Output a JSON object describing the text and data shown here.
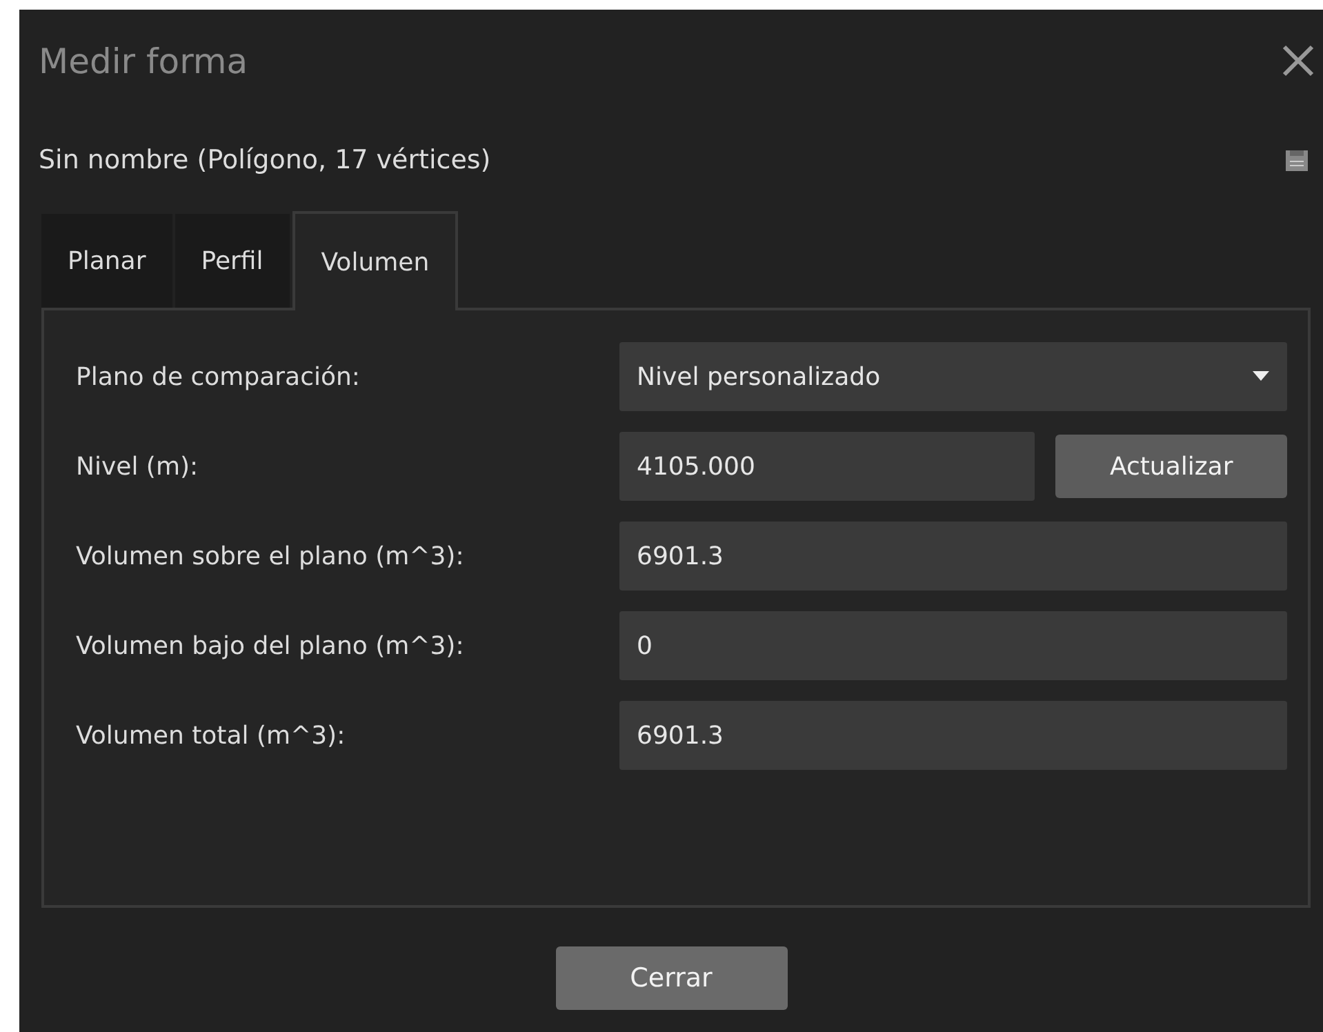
{
  "window": {
    "title": "Medir forma"
  },
  "subtitle": "Sin nombre (Polígono, 17 vértices)",
  "tabs": [
    {
      "label": "Planar",
      "selected": false
    },
    {
      "label": "Perfil",
      "selected": false
    },
    {
      "label": "Volumen",
      "selected": true
    }
  ],
  "rows": [
    {
      "kind": "dropdown",
      "label": "Plano de comparación:",
      "value": "Nivel personalizado"
    },
    {
      "kind": "input_button",
      "label": "Nivel (m):",
      "value": "4105.000",
      "button": "Actualizar"
    },
    {
      "kind": "readonly",
      "label": "Volumen sobre el plano (m^3):",
      "value": "6901.3"
    },
    {
      "kind": "readonly",
      "label": "Volumen bajo del plano (m^3):",
      "value": "0"
    },
    {
      "kind": "readonly",
      "label": "Volumen total (m^3):",
      "value": "6901.3"
    }
  ],
  "buttons": [
    "Cerrar"
  ]
}
